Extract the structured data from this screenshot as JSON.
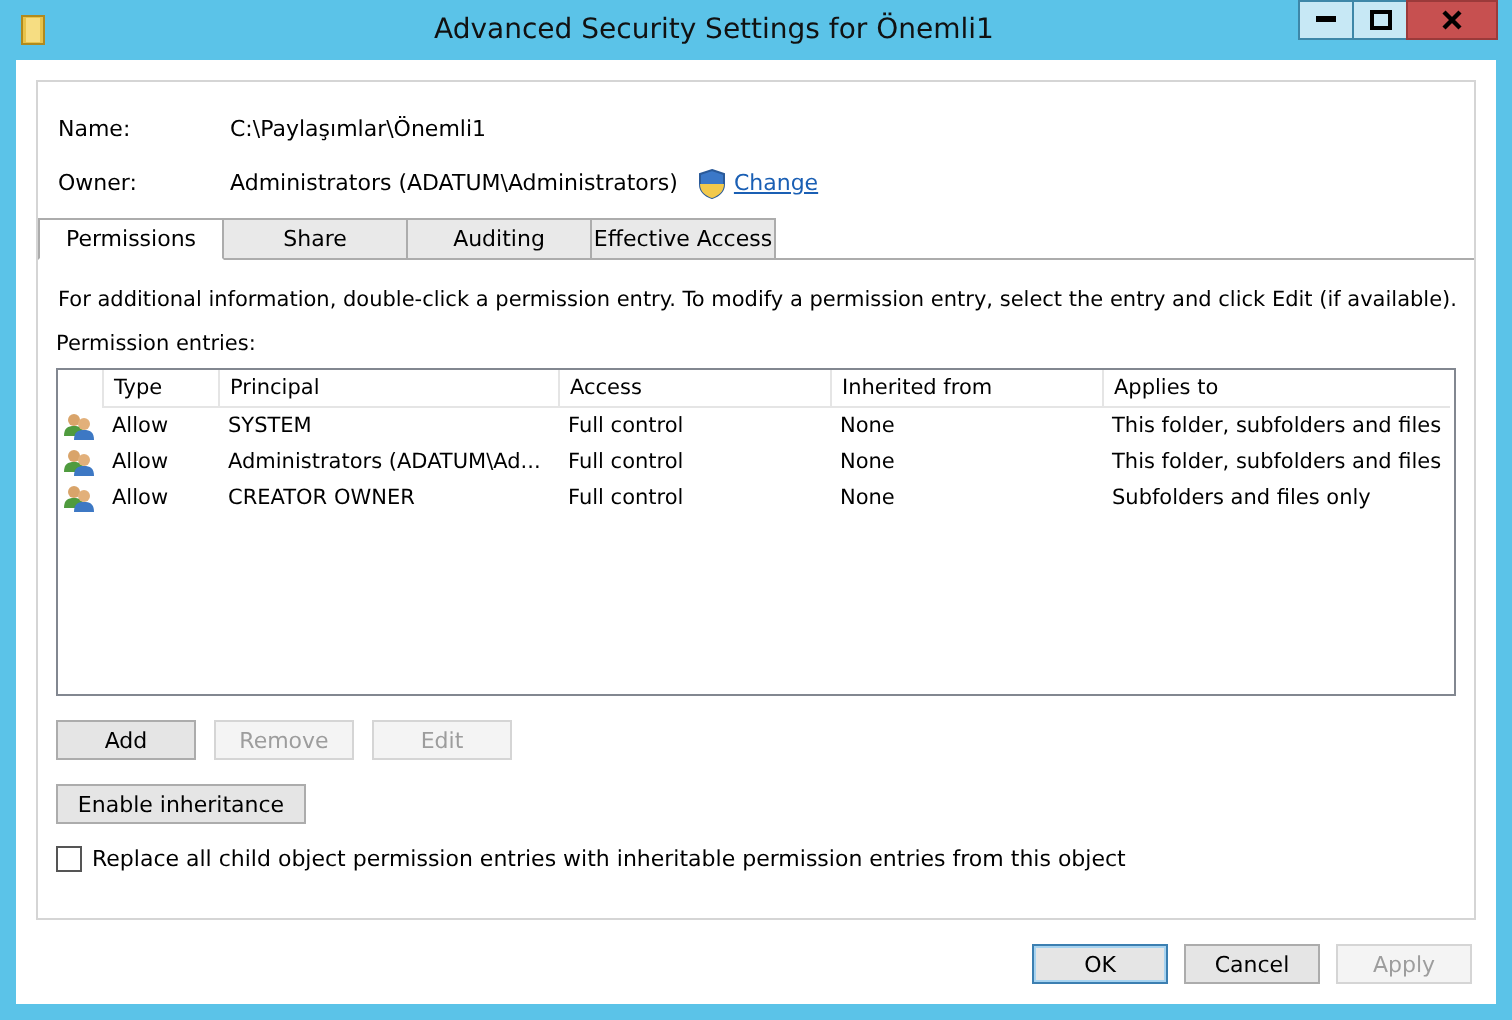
{
  "window": {
    "title": "Advanced Security Settings for Önemli1"
  },
  "name": {
    "label": "Name:",
    "value": "C:\\Paylaşımlar\\Önemli1"
  },
  "owner": {
    "label": "Owner:",
    "value": "Administrators (ADATUM\\Administrators)",
    "change_link": "Change"
  },
  "tabs": [
    {
      "label": "Permissions",
      "selected": true
    },
    {
      "label": "Share",
      "selected": false
    },
    {
      "label": "Auditing",
      "selected": false
    },
    {
      "label": "Effective Access",
      "selected": false
    }
  ],
  "info_text": "For additional information, double-click a permission entry. To modify a permission entry, select the entry and click Edit (if available).",
  "entries_label": "Permission entries:",
  "table": {
    "columns": [
      "Type",
      "Principal",
      "Access",
      "Inherited from",
      "Applies to"
    ],
    "rows": [
      {
        "type": "Allow",
        "principal": "SYSTEM",
        "access": "Full control",
        "inherited_from": "None",
        "applies_to": "This folder, subfolders and files"
      },
      {
        "type": "Allow",
        "principal": "Administrators (ADATUM\\Ad...",
        "access": "Full control",
        "inherited_from": "None",
        "applies_to": "This folder, subfolders and files"
      },
      {
        "type": "Allow",
        "principal": "CREATOR OWNER",
        "access": "Full control",
        "inherited_from": "None",
        "applies_to": "Subfolders and files only"
      }
    ]
  },
  "entry_buttons": [
    {
      "label": "Add",
      "disabled": false
    },
    {
      "label": "Remove",
      "disabled": true
    },
    {
      "label": "Edit",
      "disabled": true
    }
  ],
  "inheritance_button": "Enable inheritance",
  "replace_checkbox": {
    "label": "Replace all child object permission entries with inheritable permission entries from this object",
    "checked": false
  },
  "dialog_buttons": [
    {
      "label": "OK",
      "disabled": false,
      "default": true
    },
    {
      "label": "Cancel",
      "disabled": false,
      "default": false
    },
    {
      "label": "Apply",
      "disabled": true,
      "default": false
    }
  ]
}
